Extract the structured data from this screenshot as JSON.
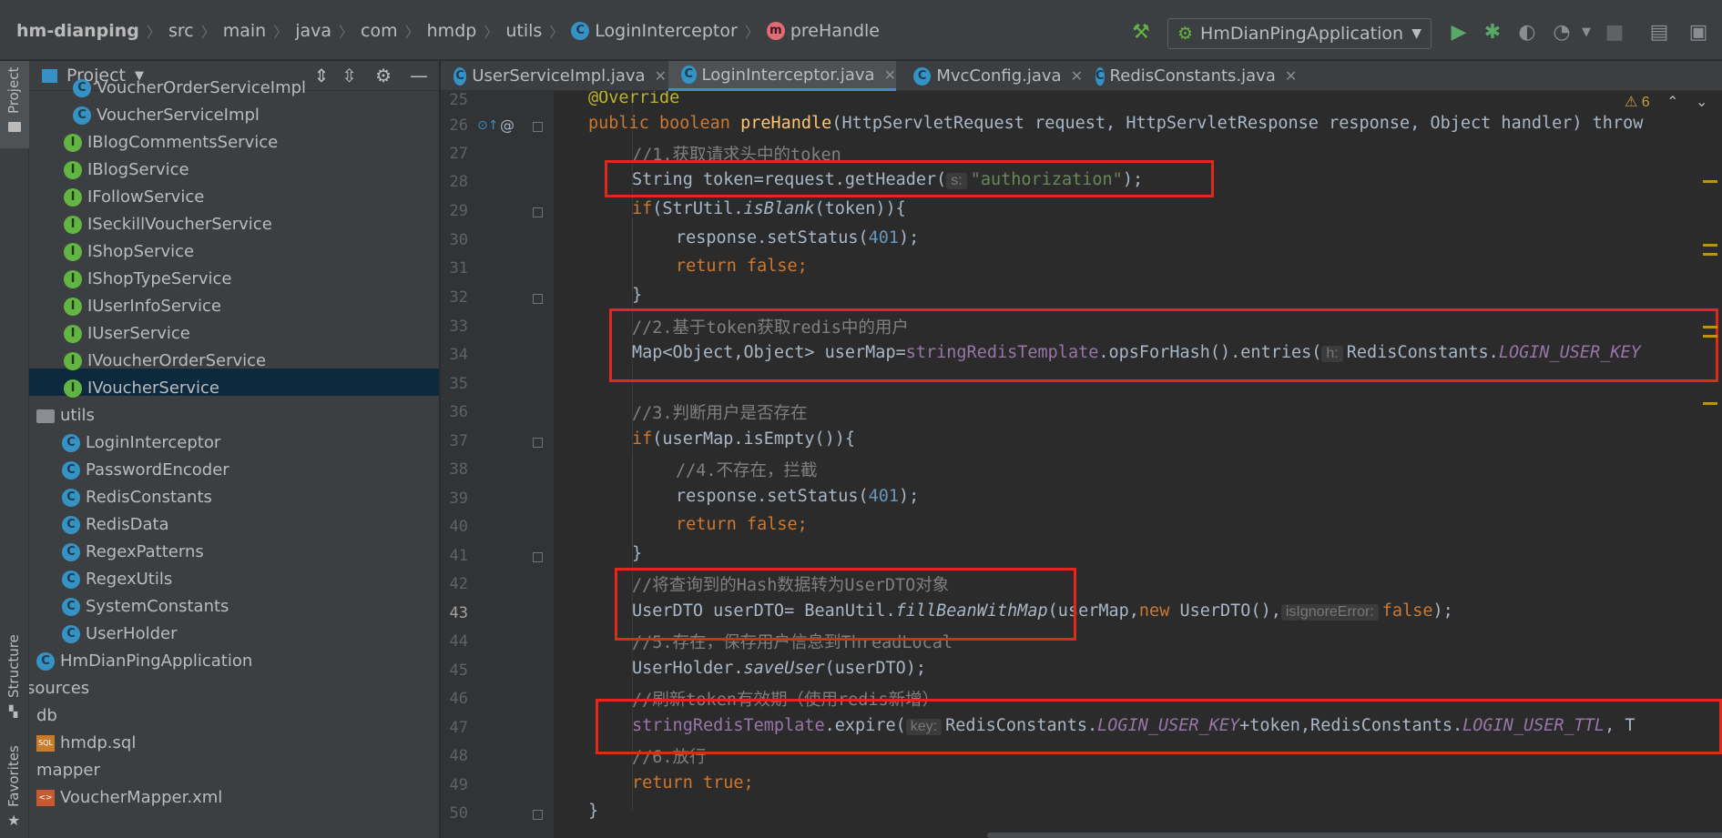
{
  "breadcrumbs": [
    "hm-dianping",
    "src",
    "main",
    "java",
    "com",
    "hmdp",
    "utils",
    "LoginInterceptor",
    "preHandle"
  ],
  "run_config": {
    "label": "HmDianPingApplication"
  },
  "left_strip": {
    "project": "Project",
    "structure": "Structure",
    "favorites": "Favorites"
  },
  "project_panel": {
    "title": "Project",
    "items": [
      {
        "label": "VoucherOrderServiceImpl",
        "icon": "class-icon"
      },
      {
        "label": "VoucherServiceImpl",
        "icon": "class-icon"
      },
      {
        "label": "IBlogCommentsService",
        "icon": "interface-icon"
      },
      {
        "label": "IBlogService",
        "icon": "interface-icon"
      },
      {
        "label": "IFollowService",
        "icon": "interface-icon"
      },
      {
        "label": "ISeckillVoucherService",
        "icon": "interface-icon"
      },
      {
        "label": "IShopService",
        "icon": "interface-icon"
      },
      {
        "label": "IShopTypeService",
        "icon": "interface-icon"
      },
      {
        "label": "IUserInfoService",
        "icon": "interface-icon"
      },
      {
        "label": "IUserService",
        "icon": "interface-icon"
      },
      {
        "label": "IVoucherOrderService",
        "icon": "interface-icon"
      },
      {
        "label": "IVoucherService",
        "icon": "interface-icon"
      },
      {
        "label": "utils",
        "icon": "folder-icon"
      },
      {
        "label": "LoginInterceptor",
        "icon": "class-icon"
      },
      {
        "label": "PasswordEncoder",
        "icon": "class-icon"
      },
      {
        "label": "RedisConstants",
        "icon": "class-icon"
      },
      {
        "label": "RedisData",
        "icon": "class-icon"
      },
      {
        "label": "RegexPatterns",
        "icon": "class-icon"
      },
      {
        "label": "RegexUtils",
        "icon": "class-icon"
      },
      {
        "label": "SystemConstants",
        "icon": "class-icon"
      },
      {
        "label": "UserHolder",
        "icon": "class-icon"
      },
      {
        "label": "HmDianPingApplication",
        "icon": "app-icon"
      },
      {
        "label": "sources",
        "icon": "none"
      },
      {
        "label": "db",
        "icon": "none"
      },
      {
        "label": "hmdp.sql",
        "icon": "sql-icon"
      },
      {
        "label": "mapper",
        "icon": "none"
      },
      {
        "label": "VoucherMapper.xml",
        "icon": "xml-icon"
      }
    ]
  },
  "tabs": [
    {
      "label": "UserServiceImpl.java"
    },
    {
      "label": "LoginInterceptor.java",
      "active": true
    },
    {
      "label": "MvcConfig.java"
    },
    {
      "label": "RedisConstants.java"
    }
  ],
  "editor": {
    "warning_count": "6",
    "line_numbers": [
      "25",
      "26",
      "27",
      "28",
      "29",
      "30",
      "31",
      "32",
      "33",
      "34",
      "35",
      "36",
      "37",
      "38",
      "39",
      "40",
      "41",
      "42",
      "43",
      "44",
      "45",
      "46",
      "47",
      "48",
      "49",
      "50"
    ],
    "lines": {
      "l25": "@Override",
      "l26_kw1": "public boolean ",
      "l26_fn": "preHandle",
      "l26_rest": "(HttpServletRequest request, HttpServletResponse response, Object handler) throw",
      "l27": "//1.获取请求头中的token",
      "l28_a": "String token=request.getHeader(",
      "l28_hint": "s:",
      "l28_str": "\"authorization\"",
      "l28_b": ");",
      "l29_a": "if",
      "l29_b": "(StrUtil.",
      "l29_c": "isBlank",
      "l29_d": "(token)){",
      "l30_a": "response.setStatus(",
      "l30_num": "401",
      "l30_b": ");",
      "l31": "return false;",
      "l32": "}",
      "l33": "//2.基于token获取redis中的用户",
      "l34_a": "Map<Object,Object> userMap=",
      "l34_fld": "stringRedisTemplate",
      "l34_b": ".opsForHash().entries(",
      "l34_hint": "h:",
      "l34_c": "RedisConstants.",
      "l34_cst": "LOGIN_USER_KEY",
      "l36": "//3.判断用户是否存在",
      "l37_a": "if",
      "l37_b": "(userMap.isEmpty()){",
      "l38": "//4.不存在，拦截",
      "l39_a": "response.setStatus(",
      "l39_num": "401",
      "l39_b": ");",
      "l40": "return false;",
      "l41": "}",
      "l42": "//将查询到的Hash数据转为UserDTO对象",
      "l43_a": "UserDTO userDTO= BeanUtil.",
      "l43_fn": "fillBeanWithMap",
      "l43_b": "(userMap,",
      "l43_new": "new ",
      "l43_c": "UserDTO(),",
      "l43_hint": "isIgnoreError:",
      "l43_false": "false",
      "l43_d": ");",
      "l44": "//5.存在，保存用户信息到ThreadLocal",
      "l45_a": "UserHolder.",
      "l45_fn": "saveUser",
      "l45_b": "(userDTO);",
      "l46": "//刷新token有效期（使用redis新增）",
      "l47_fld": "stringRedisTemplate",
      "l47_a": ".expire(",
      "l47_hint": "key:",
      "l47_b": "RedisConstants.",
      "l47_cst1": "LOGIN_USER_KEY",
      "l47_c": "+token,RedisConstants.",
      "l47_cst2": "LOGIN_USER_TTL",
      "l47_d": ", T",
      "l48": "//6.放行",
      "l49": "return true;",
      "l50": "}"
    }
  },
  "colors": {
    "highlight_box": "#e0291a",
    "keyword": "#cc7832",
    "string": "#6a8759",
    "field": "#9876aa",
    "comment": "#808080"
  }
}
